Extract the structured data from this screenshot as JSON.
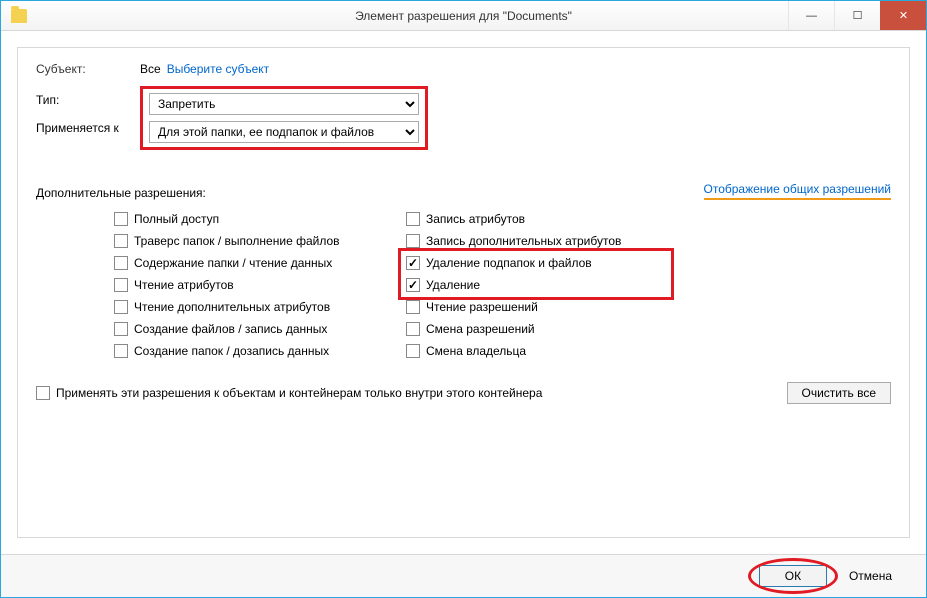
{
  "titlebar": {
    "title": "Элемент разрешения для \"Documents\""
  },
  "subject": {
    "label": "Субъект:",
    "all": "Все",
    "select_link": "Выберите субъект"
  },
  "type": {
    "label": "Тип:",
    "value": "Запретить"
  },
  "applies": {
    "label": "Применяется к",
    "value": "Для этой папки, ее подпапок и файлов"
  },
  "perm_header": "Дополнительные разрешения:",
  "view_basic_link": "Отображение общих разрешений",
  "perms_left": [
    {
      "label": "Полный доступ",
      "checked": false
    },
    {
      "label": "Траверс папок / выполнение файлов",
      "checked": false
    },
    {
      "label": "Содержание папки / чтение данных",
      "checked": false
    },
    {
      "label": "Чтение атрибутов",
      "checked": false
    },
    {
      "label": "Чтение дополнительных атрибутов",
      "checked": false
    },
    {
      "label": "Создание файлов / запись данных",
      "checked": false
    },
    {
      "label": "Создание папок / дозапись данных",
      "checked": false
    }
  ],
  "perms_right": [
    {
      "label": "Запись атрибутов",
      "checked": false
    },
    {
      "label": "Запись дополнительных атрибутов",
      "checked": false
    },
    {
      "label": "Удаление подпапок и файлов",
      "checked": true
    },
    {
      "label": "Удаление",
      "checked": true
    },
    {
      "label": "Чтение разрешений",
      "checked": false
    },
    {
      "label": "Смена разрешений",
      "checked": false
    },
    {
      "label": "Смена владельца",
      "checked": false
    }
  ],
  "apply_within": {
    "label": "Применять эти разрешения к объектам и контейнерам только внутри этого контейнера",
    "checked": false
  },
  "buttons": {
    "clear": "Очистить все",
    "ok": "ОК",
    "cancel": "Отмена"
  }
}
